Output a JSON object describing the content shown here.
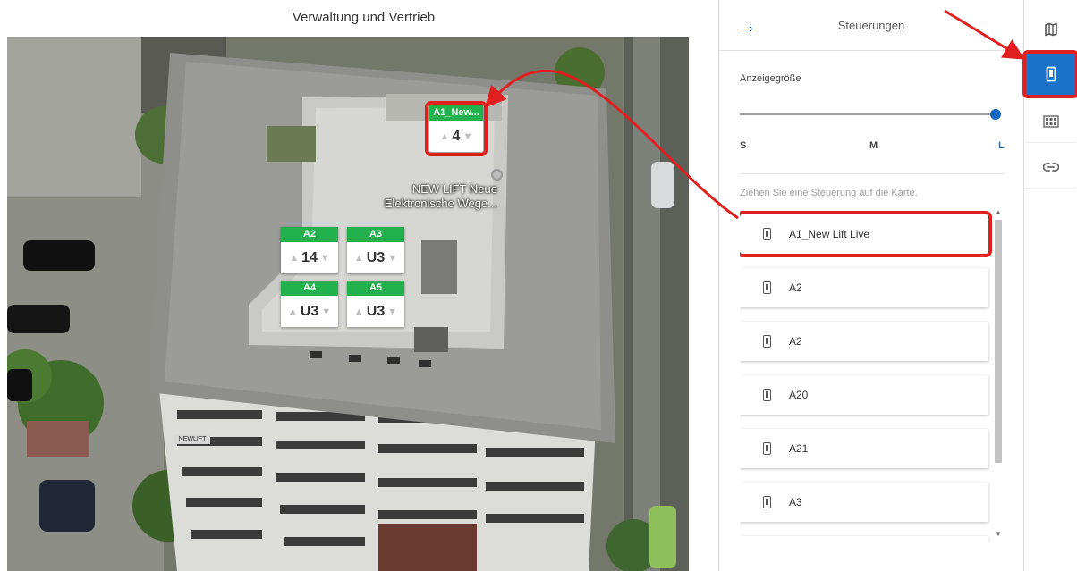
{
  "map": {
    "title": "Verwaltung und Vertrieb",
    "poi_label": [
      "NEW LIFT Neue",
      "Elektronische Wege..."
    ],
    "sign_text": "NEWLIFT",
    "lifts": [
      {
        "name": "A1_New...",
        "floor": "4",
        "highlighted": true
      },
      {
        "name": "A2",
        "floor": "14"
      },
      {
        "name": "A3",
        "floor": "U3"
      },
      {
        "name": "A4",
        "floor": "U3"
      },
      {
        "name": "A5",
        "floor": "U3"
      }
    ]
  },
  "panel": {
    "title": "Steuerungen",
    "display_size_label": "Anzeigegröße",
    "size_options": [
      "S",
      "M",
      "L"
    ],
    "size_selected": "L",
    "drag_hint": "Ziehen Sie eine Steuerung auf die Karte.",
    "controls": [
      {
        "label": "A1_New Lift Live",
        "highlighted": true
      },
      {
        "label": "A2"
      },
      {
        "label": "A2"
      },
      {
        "label": "A20"
      },
      {
        "label": "A21"
      },
      {
        "label": "A3"
      }
    ]
  },
  "rail": {
    "buttons": [
      {
        "icon": "map-icon"
      },
      {
        "icon": "lift-control-icon",
        "active": true,
        "highlighted": true
      },
      {
        "icon": "floor-grid-icon"
      },
      {
        "icon": "link-icon"
      }
    ]
  },
  "colors": {
    "accent": "#1a73c9",
    "lift_header": "#22b14c",
    "highlight": "#e02020"
  }
}
